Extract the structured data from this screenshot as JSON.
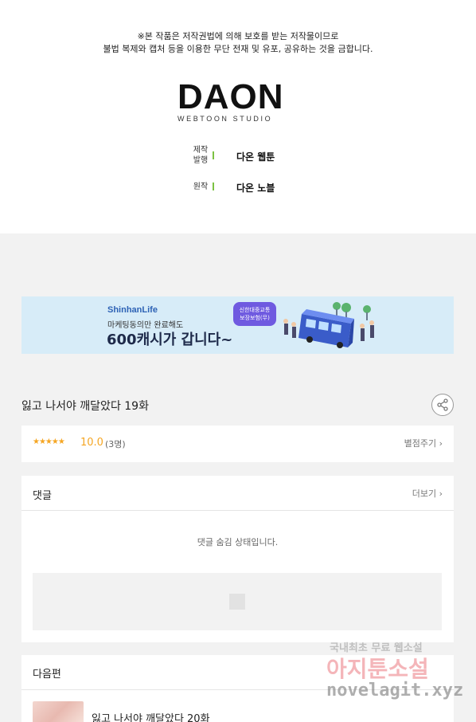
{
  "notice": {
    "line1": "※본 작품은 저작권법에 의해 보호를 받는 저작물이므로",
    "line2": "불법 복제와 캡처 등을 이용한 무단 전재 및 유포, 공유하는 것을 금합니다."
  },
  "logo": {
    "main": "DAON",
    "sub": "WEBTOON STUDIO"
  },
  "credits": [
    {
      "label_line1": "제작",
      "label_line2": "발행",
      "value": "다온 웹툰"
    },
    {
      "label_line1": "원작",
      "label_line2": "",
      "value": "다온 노블"
    }
  ],
  "banner": {
    "brand": "ShinhanLife",
    "subtitle": "마케팅동의만 완료해도",
    "headline": "600캐시가 갑니다~",
    "badge_line1": "신한대중교통",
    "badge_line2": "보장보험(무)"
  },
  "episode": {
    "title": "잃고 나서야 깨달았다 19화"
  },
  "rating": {
    "stars": "★★★★★",
    "score": "10.0",
    "count": "(3명)",
    "rate_button": "별점주기 ›"
  },
  "comments": {
    "title": "댓글",
    "more": "더보기 ›",
    "hidden_text": "댓글 숨김 상태입니다."
  },
  "next_episode": {
    "header": "다음편",
    "title": "잃고 나서야 깨달았다 20화"
  },
  "watermark": {
    "line1": "국내최초 무료 웹소설",
    "line2": "아지툰소설",
    "line3": "novelagit.xyz"
  },
  "icons": {
    "share": "share-icon",
    "placeholder": "image-placeholder-icon"
  },
  "colors": {
    "accent_green": "#7cc242",
    "star": "#f5a623",
    "banner_bg": "#d7ecf8"
  }
}
